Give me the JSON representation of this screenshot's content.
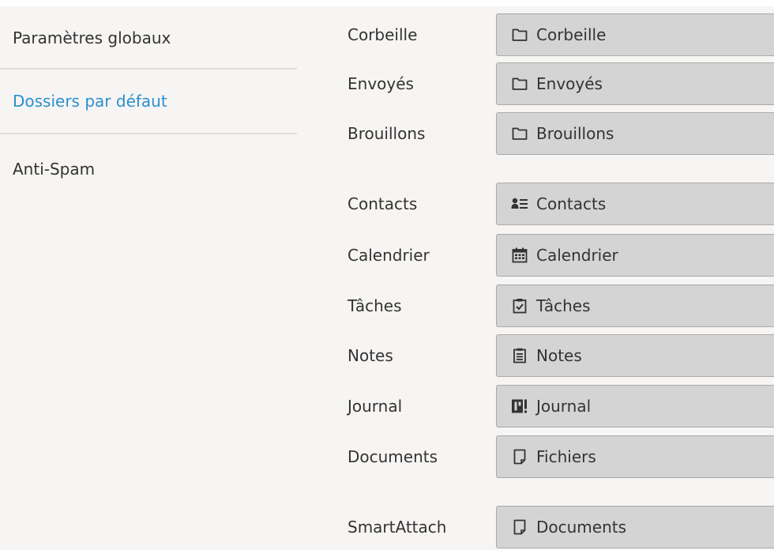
{
  "nav": {
    "items": [
      {
        "label": "Paramètres globaux",
        "active": false
      },
      {
        "label": "Dossiers par défaut",
        "active": true
      },
      {
        "label": "Anti-Spam",
        "active": false
      }
    ]
  },
  "folders": [
    {
      "label": "Corbeille",
      "value": "Corbeille",
      "icon": "folder-icon"
    },
    {
      "label": "Envoyés",
      "value": "Envoyés",
      "icon": "folder-icon"
    },
    {
      "label": "Brouillons",
      "value": "Brouillons",
      "icon": "folder-icon"
    },
    {
      "label": "Contacts",
      "value": "Contacts",
      "icon": "contacts-icon"
    },
    {
      "label": "Calendrier",
      "value": "Calendrier",
      "icon": "calendar-icon"
    },
    {
      "label": "Tâches",
      "value": "Tâches",
      "icon": "tasks-icon"
    },
    {
      "label": "Notes",
      "value": "Notes",
      "icon": "notes-icon"
    },
    {
      "label": "Journal",
      "value": "Journal",
      "icon": "journal-icon"
    },
    {
      "label": "Documents",
      "value": "Fichiers",
      "icon": "file-icon"
    },
    {
      "label": "SmartAttach",
      "value": "Documents",
      "icon": "file-icon"
    }
  ],
  "colors": {
    "accent": "#2a8fcf",
    "text": "#333333",
    "background": "#f7f5f3",
    "button": "#d4d4d4",
    "button_border": "#aaaaaa"
  }
}
